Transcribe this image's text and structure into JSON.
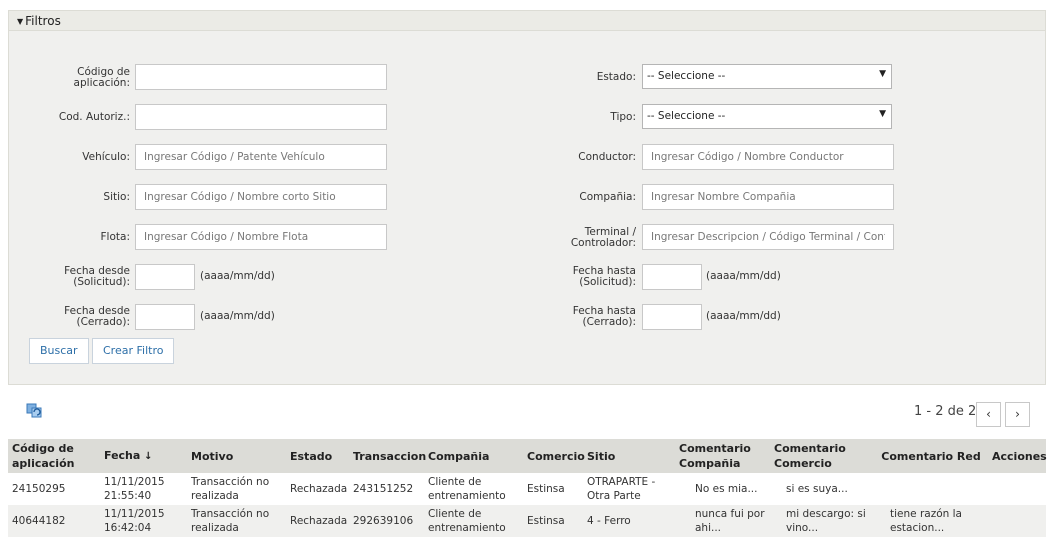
{
  "filters": {
    "title": "Filtros",
    "codigo_aplicacion_label": "Código de aplicación:",
    "cod_autoriz_label": "Cod. Autoriz.:",
    "vehiculo_label": "Vehículo:",
    "vehiculo_placeholder": "Ingresar Código / Patente Vehículo",
    "sitio_label": "Sitio:",
    "sitio_placeholder": "Ingresar Código / Nombre corto Sitio",
    "flota_label": "Flota:",
    "flota_placeholder": "Ingresar Código / Nombre Flota",
    "fecha_desde_solicitud_label": "Fecha desde (Solicitud):",
    "fecha_desde_cerrado_label": "Fecha desde (Cerrado):",
    "date_format": "(aaaa/mm/dd)",
    "estado_label": "Estado:",
    "estado_value": "-- Seleccione --",
    "tipo_label": "Tipo:",
    "tipo_value": "-- Seleccione --",
    "conductor_label": "Conductor:",
    "conductor_placeholder": "Ingresar Código / Nombre Conductor",
    "compania_label": "Compañia:",
    "compania_placeholder": "Ingresar Nombre Compañia",
    "terminal_label": "Terminal / Controlador:",
    "terminal_placeholder": "Ingresar Descripcion / Código Terminal / Contro",
    "fecha_hasta_solicitud_label": "Fecha hasta (Solicitud):",
    "fecha_hasta_cerrado_label": "Fecha hasta (Cerrado):",
    "buscar_label": "Buscar",
    "crear_filtro_label": "Crear Filtro"
  },
  "pager": {
    "range": "1 - 2",
    "of_label": "de",
    "total": "2",
    "prev_icon": "‹",
    "next_icon": "›"
  },
  "table": {
    "headers": {
      "codigo": "Código de aplicación",
      "fecha": "Fecha",
      "fecha_sort_icon": "↓",
      "motivo": "Motivo",
      "estado": "Estado",
      "transaccion": "Transaccion",
      "compania": "Compañia",
      "comercio": "Comercio",
      "sitio": "Sitio",
      "comentario_compania": "Comentario Compañia",
      "comentario_comercio": "Comentario Comercio",
      "comentario_red": "Comentario Red",
      "acciones": "Acciones"
    },
    "rows": [
      {
        "codigo": "24150295",
        "fecha": "11/11/2015 21:55:40",
        "motivo": "Transacción no realizada",
        "estado": "Rechazada",
        "transaccion": "243151252",
        "compania": "Cliente de entrenamiento",
        "comercio": "Estinsa",
        "sitio": "OTRAPARTE - Otra Parte",
        "comentario_compania": "No es mia...",
        "comentario_comercio": "si es suya...",
        "comentario_red": ""
      },
      {
        "codigo": "40644182",
        "fecha": "11/11/2015 16:42:04",
        "motivo": "Transacción no realizada",
        "estado": "Rechazada",
        "transaccion": "292639106",
        "compania": "Cliente de entrenamiento",
        "comercio": "Estinsa",
        "sitio": "4 - Ferro",
        "comentario_compania": "nunca fui por ahi...",
        "comentario_comercio": "mi descargo: si vino...",
        "comentario_red": "tiene razón la estacion..."
      }
    ]
  },
  "icons": {
    "refresh": "refresh-icon",
    "caret": "caret-down-icon",
    "select_arrow": "dropdown-arrow-icon"
  },
  "colors": {
    "link": "#2d6fa8",
    "header_bg": "#dcdcd7",
    "panel_bg": "#f0f0ee"
  }
}
